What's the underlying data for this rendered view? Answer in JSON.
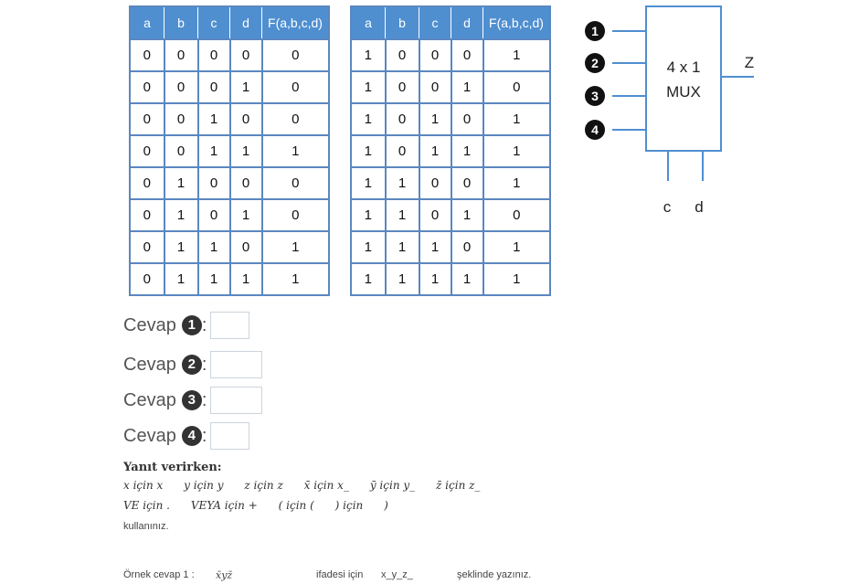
{
  "table_left": {
    "headers": [
      "a",
      "b",
      "c",
      "d",
      "F(a,b,c,d)"
    ],
    "rows": [
      [
        "0",
        "0",
        "0",
        "0",
        "0"
      ],
      [
        "0",
        "0",
        "0",
        "1",
        "0"
      ],
      [
        "0",
        "0",
        "1",
        "0",
        "0"
      ],
      [
        "0",
        "0",
        "1",
        "1",
        "1"
      ],
      [
        "0",
        "1",
        "0",
        "0",
        "0"
      ],
      [
        "0",
        "1",
        "0",
        "1",
        "0"
      ],
      [
        "0",
        "1",
        "1",
        "0",
        "1"
      ],
      [
        "0",
        "1",
        "1",
        "1",
        "1"
      ]
    ]
  },
  "table_right": {
    "headers": [
      "a",
      "b",
      "c",
      "d",
      "F(a,b,c,d)"
    ],
    "rows": [
      [
        "1",
        "0",
        "0",
        "0",
        "1"
      ],
      [
        "1",
        "0",
        "0",
        "1",
        "0"
      ],
      [
        "1",
        "0",
        "1",
        "0",
        "1"
      ],
      [
        "1",
        "0",
        "1",
        "1",
        "1"
      ],
      [
        "1",
        "1",
        "0",
        "0",
        "1"
      ],
      [
        "1",
        "1",
        "0",
        "1",
        "0"
      ],
      [
        "1",
        "1",
        "1",
        "0",
        "1"
      ],
      [
        "1",
        "1",
        "1",
        "1",
        "1"
      ]
    ]
  },
  "mux": {
    "label_line1": "4 x 1",
    "label_line2": "MUX",
    "output": "Z",
    "select": [
      "c",
      "d"
    ],
    "inputs": [
      "1",
      "2",
      "3",
      "4"
    ]
  },
  "answers": [
    {
      "label": "Cevap",
      "num": "1",
      "colon": ":"
    },
    {
      "label": "Cevap",
      "num": "2",
      "colon": ":"
    },
    {
      "label": "Cevap",
      "num": "3",
      "colon": ":"
    },
    {
      "label": "Cevap",
      "num": "4",
      "colon": ":"
    }
  ],
  "instructions": {
    "heading": "Yanıt verirken:",
    "line1": "x için x      y için y      z için z      x̄ için x_      ȳ için y_      z̄ için z_",
    "line2": "VE için .      VEYA için +      ( için (      ) için      )",
    "line3": "kullanınız."
  },
  "example": {
    "label": "Örnek cevap 1 :",
    "expr": "x̄yz̄",
    "mid": "ifadesi için",
    "code": "x_y_z_",
    "end": "şeklinde yazınız."
  },
  "colors": {
    "header_blue": "#4f8fd0",
    "border_blue": "#5b87c0",
    "wire_blue": "#4f8fd0"
  }
}
